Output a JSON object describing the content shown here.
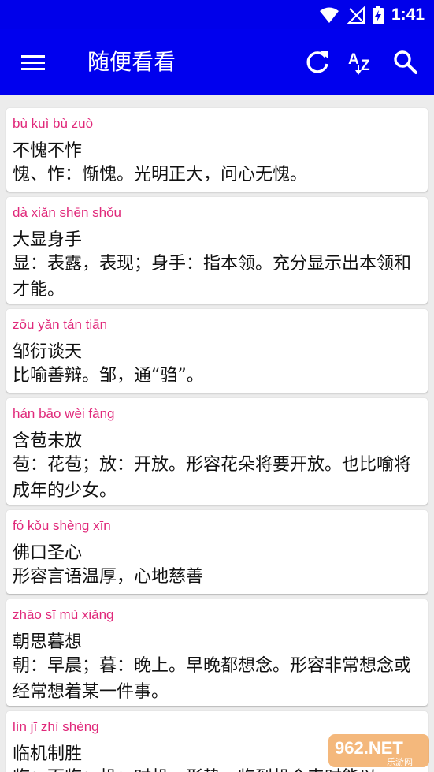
{
  "status_bar": {
    "time": "1:41"
  },
  "app_bar": {
    "title": "随便看看",
    "actions": [
      "refresh-icon",
      "sort-az-icon",
      "search-icon"
    ]
  },
  "idioms": [
    {
      "pinyin": "bù kuì bù zuò",
      "word": "不愧不怍",
      "meaning": "愧、怍：惭愧。光明正大，问心无愧。"
    },
    {
      "pinyin": "dà xiǎn shēn shǒu",
      "word": "大显身手",
      "meaning": "显：表露，表现；身手：指本领。充分显示出本领和才能。"
    },
    {
      "pinyin": "zōu yǎn tán tiān",
      "word": "邹衍谈天",
      "meaning": "比喻善辩。邹，通“驺”。"
    },
    {
      "pinyin": "hán bāo wèi fàng",
      "word": "含苞未放",
      "meaning": "苞：花苞；放：开放。形容花朵将要开放。也比喻将成年的少女。"
    },
    {
      "pinyin": "fó kǒu shèng xīn",
      "word": "佛口圣心",
      "meaning": "形容言语温厚，心地慈善"
    },
    {
      "pinyin": "zhāo sī mù xiǎng",
      "word": "朝思暮想",
      "meaning": "朝：早晨；暮：晚上。早晚都想念。形容非常想念或经常想着某一件事。"
    },
    {
      "pinyin": "lín jī zhì shèng",
      "word": "临机制胜",
      "meaning": "临：面临；机：时机。形势，临到机会来时能以"
    }
  ],
  "watermark": {
    "text": "962.NET",
    "subtext": "乐游网"
  }
}
